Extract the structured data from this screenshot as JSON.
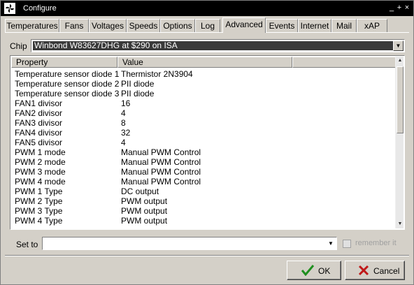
{
  "window": {
    "title": "Configure",
    "controls": [
      "_",
      "+",
      "×"
    ]
  },
  "tabs": [
    "Temperatures",
    "Fans",
    "Voltages",
    "Speeds",
    "Options",
    "Log",
    "Advanced",
    "Events",
    "Internet",
    "Mail",
    "xAP"
  ],
  "active_tab": "Advanced",
  "chip": {
    "label": "Chip",
    "value": "Winbond W83627DHG at $290 on ISA"
  },
  "table": {
    "columns": [
      "Property",
      "Value"
    ],
    "rows": [
      [
        "Temperature sensor diode 1",
        "Thermistor 2N3904"
      ],
      [
        "Temperature sensor diode 2",
        "PII diode"
      ],
      [
        "Temperature sensor diode 3",
        "PII diode"
      ],
      [
        "FAN1 divisor",
        "16"
      ],
      [
        "FAN2 divisor",
        "4"
      ],
      [
        "FAN3 divisor",
        "8"
      ],
      [
        "FAN4 divisor",
        "32"
      ],
      [
        "FAN5 divisor",
        "4"
      ],
      [
        "PWM 1 mode",
        "Manual PWM Control"
      ],
      [
        "PWM 2 mode",
        "Manual PWM Control"
      ],
      [
        "PWM 3 mode",
        "Manual PWM Control"
      ],
      [
        "PWM 4 mode",
        "Manual PWM Control"
      ],
      [
        "PWM 1 Type",
        "DC output"
      ],
      [
        "PWM 2 Type",
        "PWM output"
      ],
      [
        "PWM 3 Type",
        "PWM output"
      ],
      [
        "PWM 4 Type",
        "PWM output"
      ]
    ]
  },
  "set_to": {
    "label": "Set to",
    "value": ""
  },
  "remember": {
    "label": "remember it",
    "checked": false
  },
  "buttons": {
    "ok": "OK",
    "cancel": "Cancel"
  },
  "colors": {
    "ok_check": "#1f8f1f",
    "cancel_x": "#c01818"
  }
}
